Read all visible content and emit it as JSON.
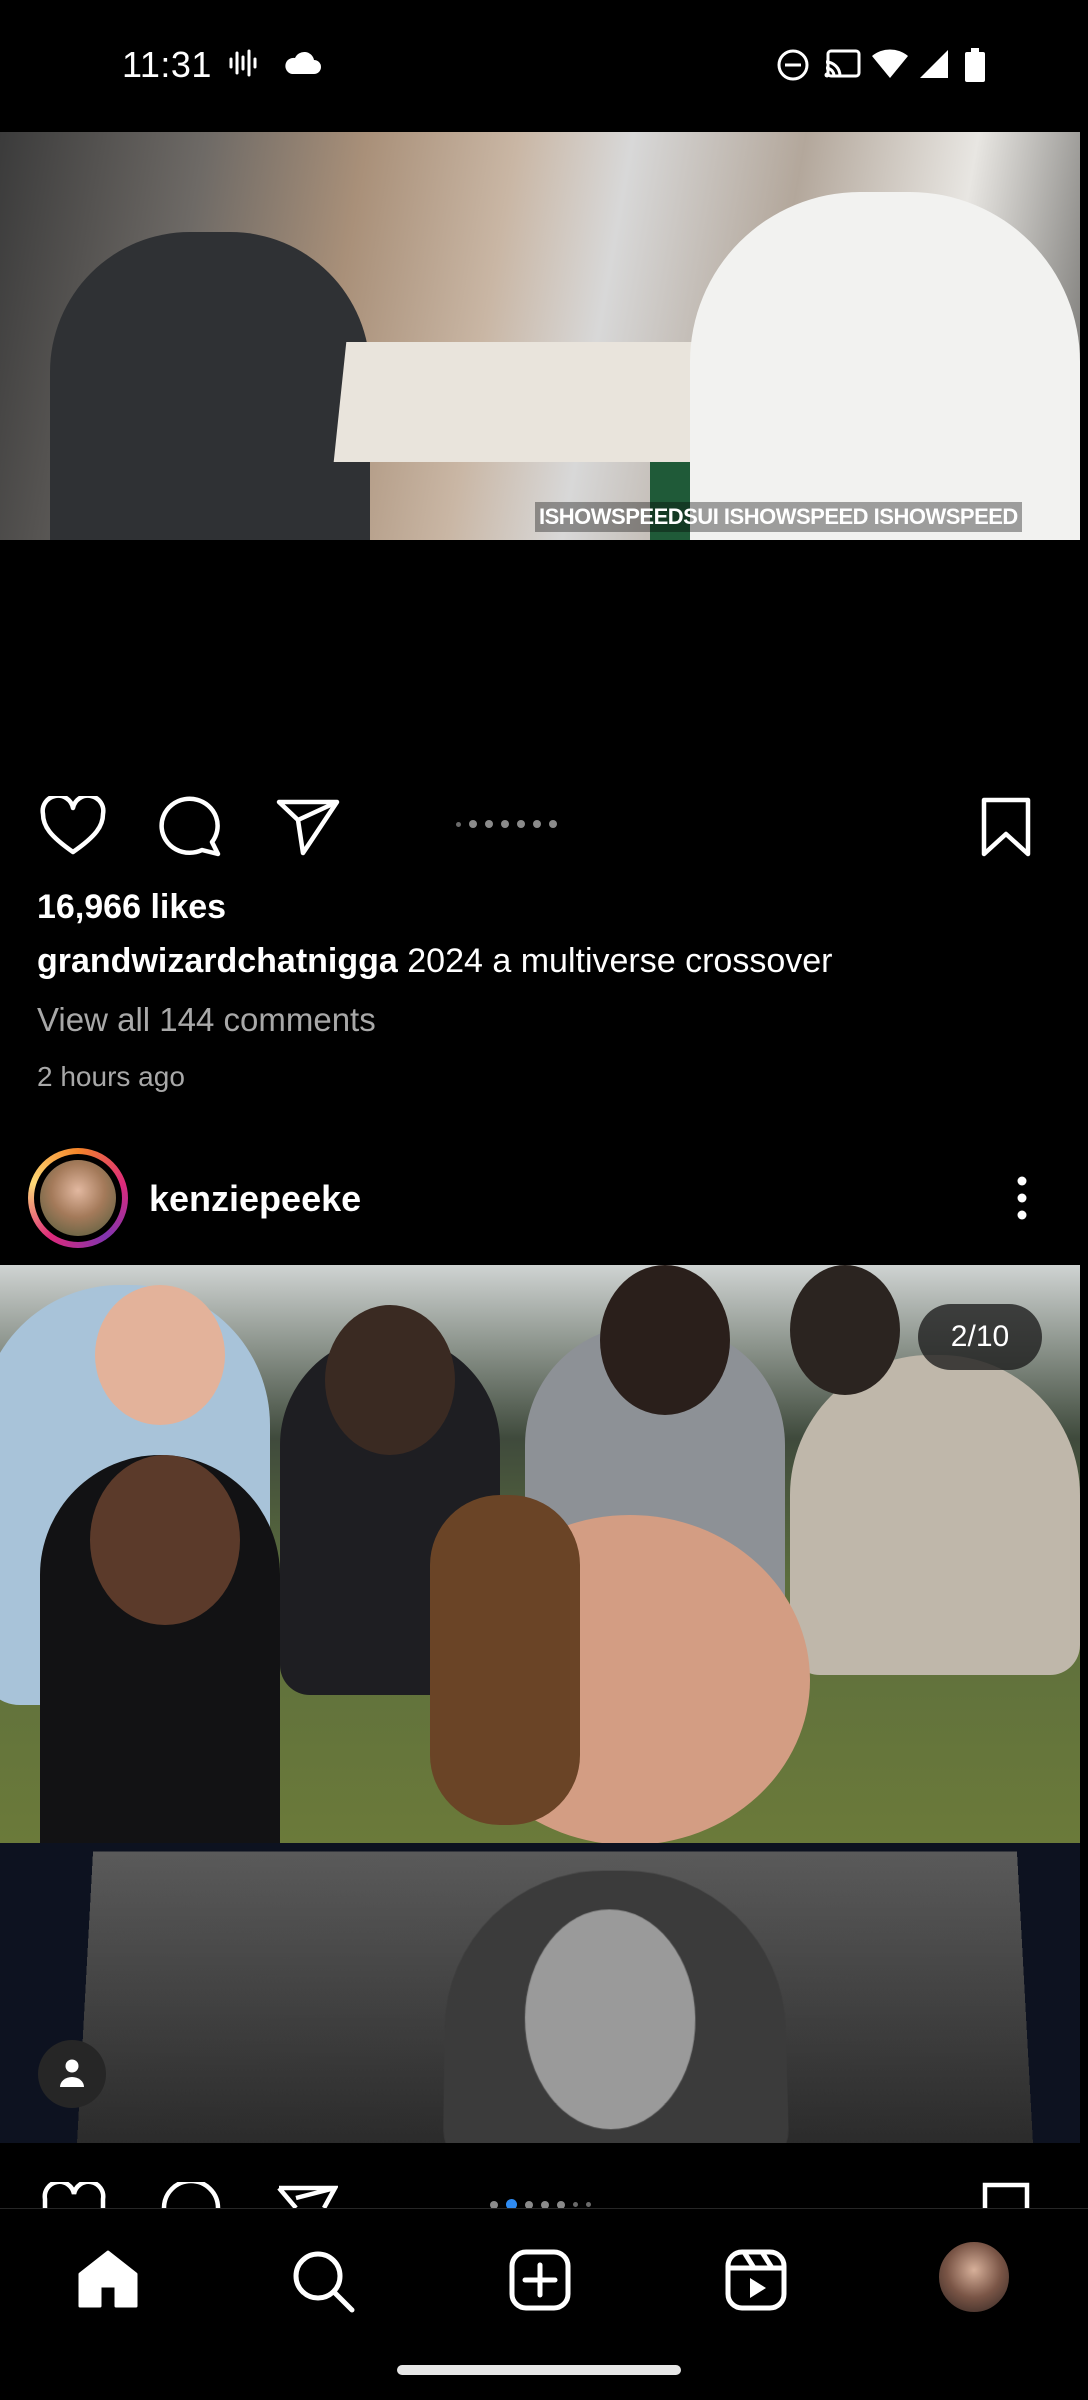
{
  "status_bar": {
    "time": "11:31",
    "left_icons": [
      "voicemail-icon",
      "cloud-icon"
    ],
    "right_icons": [
      "do-not-disturb-icon",
      "cast-icon",
      "wifi-icon",
      "signal-icon",
      "battery-icon"
    ]
  },
  "post1": {
    "media_watermark": "ISHOWSPEEDSUI  ISHOWSPEED  ISHOWSPEED",
    "likes": "16,966 likes",
    "caption_user": "grandwizardchatnigga",
    "caption_text": " 2024 a multiverse crossover",
    "view_comments": "View all 144 comments",
    "timestamp": "2 hours ago"
  },
  "post2": {
    "username": "kenziepeeke",
    "pager": "2/10"
  },
  "bottom_nav": {
    "items": [
      "home",
      "search",
      "create",
      "reels",
      "profile"
    ]
  }
}
